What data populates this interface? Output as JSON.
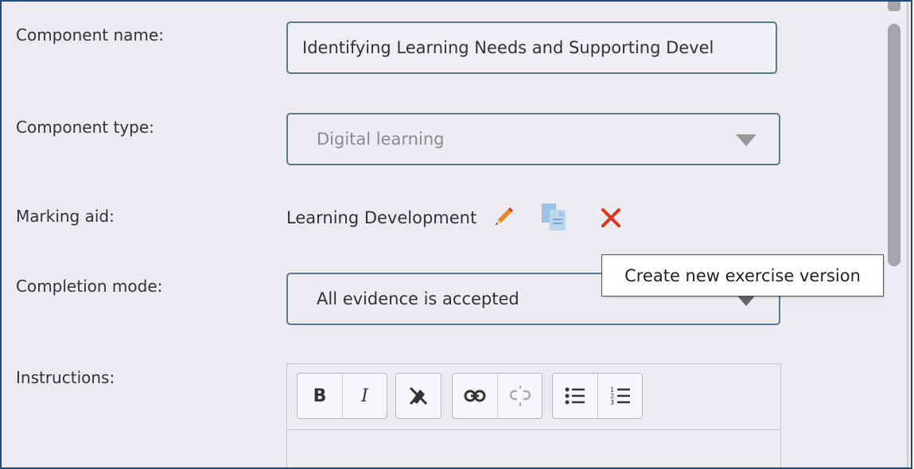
{
  "form": {
    "component_name_label": "Component name:",
    "component_name_value": "Identifying Learning Needs and Supporting Devel",
    "component_type_label": "Component type:",
    "component_type_value": "Digital learning",
    "marking_aid_label": "Marking aid:",
    "marking_aid_value": "Learning Development",
    "completion_mode_label": "Completion mode:",
    "completion_mode_value": "All evidence is accepted",
    "instructions_label": "Instructions:"
  },
  "tooltip": {
    "text": "Create new exercise version"
  },
  "editor_toolbar": {
    "bold": "B",
    "italic": "I"
  },
  "colors": {
    "panel_background": "#edebf1",
    "frame_border": "#1f4e79",
    "field_border": "#5a7a8c",
    "delete_red": "#d9381e",
    "pencil_orange": "#e8862a"
  },
  "icons": [
    "pencil-icon",
    "copy-icon",
    "delete-icon",
    "remove-format-icon",
    "link-icon",
    "unlink-icon",
    "bullet-list-icon",
    "numbered-list-icon"
  ]
}
